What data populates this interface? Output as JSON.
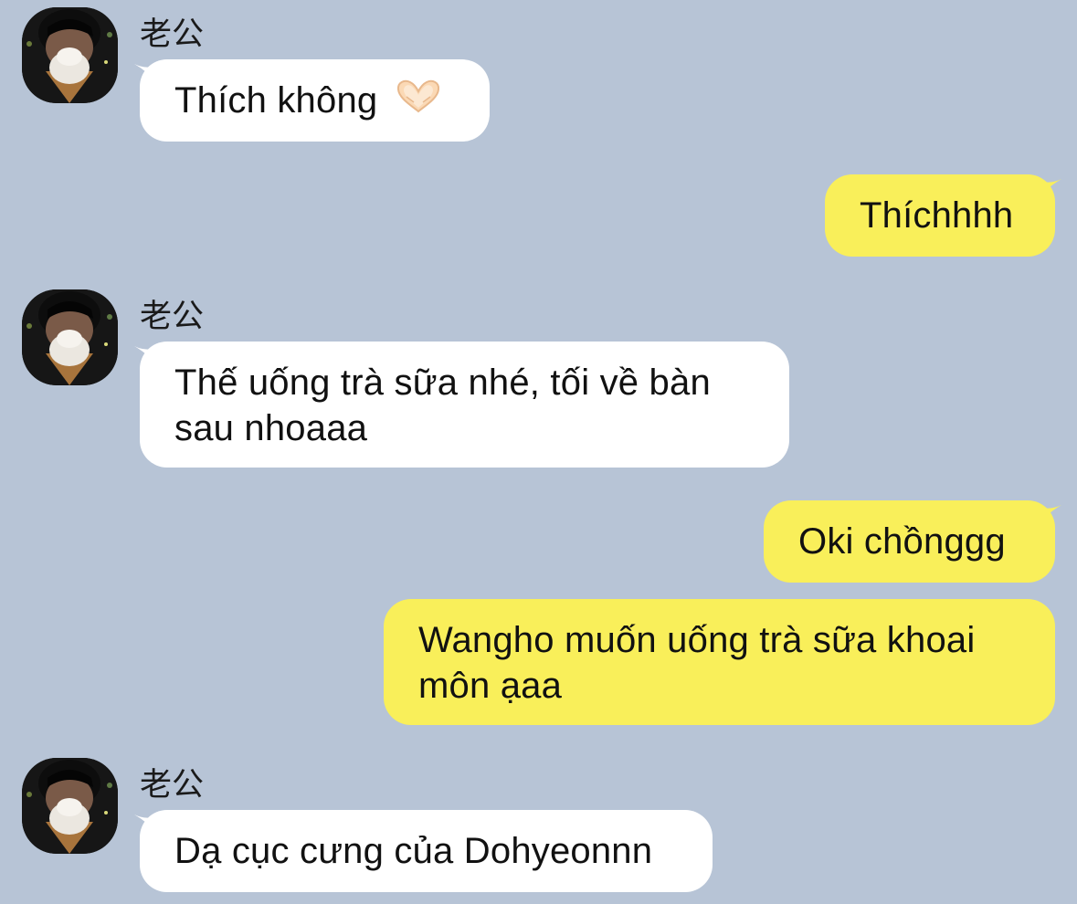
{
  "contact": {
    "name": "老公"
  },
  "messages": [
    {
      "direction": "in",
      "sender": "老公",
      "text": "Thích không",
      "emoji": "heart-hands-emoji"
    },
    {
      "direction": "out",
      "text": "Thíchhhh"
    },
    {
      "direction": "in",
      "sender": "老公",
      "text": "Thế uống trà sữa nhé, tối về bàn sau nhoaaa"
    },
    {
      "direction": "out",
      "text": "Oki chồnggg"
    },
    {
      "direction": "out",
      "text": "Wangho muốn uống trà sữa khoai môn ạaa"
    },
    {
      "direction": "in",
      "sender": "老公",
      "text": "Dạ cục cưng của Dohyeonnn"
    }
  ],
  "colors": {
    "background": "#b7c4d6",
    "incoming_bubble": "#ffffff",
    "outgoing_bubble": "#f9ef5a"
  }
}
